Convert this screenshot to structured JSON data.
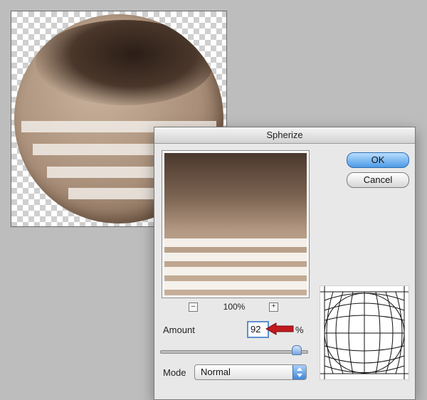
{
  "dialog": {
    "title": "Spherize",
    "ok_label": "OK",
    "cancel_label": "Cancel",
    "zoom_minus": "–",
    "zoom_plus": "+",
    "zoom_level": "100%",
    "amount_label": "Amount",
    "amount_value": "92",
    "amount_unit": "%",
    "amount_slider_percent": 92,
    "mode_label": "Mode",
    "mode_value": "Normal"
  },
  "colors": {
    "ok_button": "#4d9be6",
    "annotation_arrow": "#c1191e",
    "focus_ring": "#5d8fd0"
  },
  "icons": {
    "annotation": "red-arrow-icon",
    "select": "up-down-chevron-icon"
  }
}
